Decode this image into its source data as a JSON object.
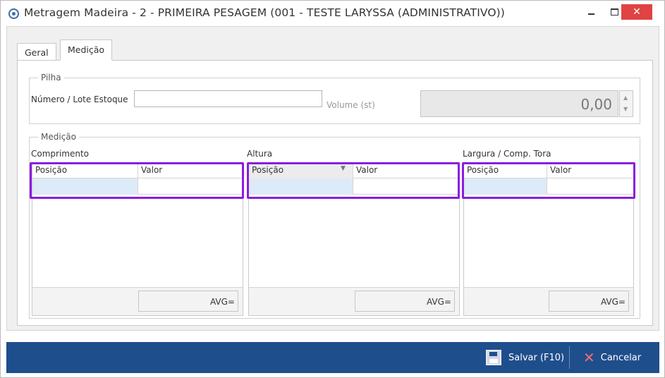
{
  "window": {
    "title": "Metragem Madeira - 2 - PRIMEIRA  PESAGEM (001 - TESTE LARYSSA (ADMINISTRATIVO))",
    "close_glyph": "✕"
  },
  "tabs": [
    {
      "label": "Geral"
    },
    {
      "label": "Medição"
    }
  ],
  "pilha": {
    "group_label": "Pilha",
    "numero_lote_label": "Número / Lote Estoque",
    "numero_lote_value": "",
    "volume_label": "Volume (st)",
    "volume_value": "0,00"
  },
  "medicao": {
    "group_label": "Medição",
    "grids": [
      {
        "title": "Comprimento",
        "col_posicao": "Posição",
        "col_valor": "Valor",
        "avg_label": "AVG="
      },
      {
        "title": "Altura",
        "col_posicao": "Posição",
        "col_valor": "Valor",
        "avg_label": "AVG="
      },
      {
        "title": "Largura / Comp. Tora",
        "col_posicao": "Posição",
        "col_valor": "Valor",
        "avg_label": "AVG="
      }
    ]
  },
  "footer": {
    "save_label": "Salvar (F10)",
    "cancel_label": "Cancelar"
  },
  "colors": {
    "accent_bar": "#1f4e8c",
    "highlight": "#8a1de0",
    "selected_cell": "#ddeaf7",
    "close_button": "#e04343"
  }
}
